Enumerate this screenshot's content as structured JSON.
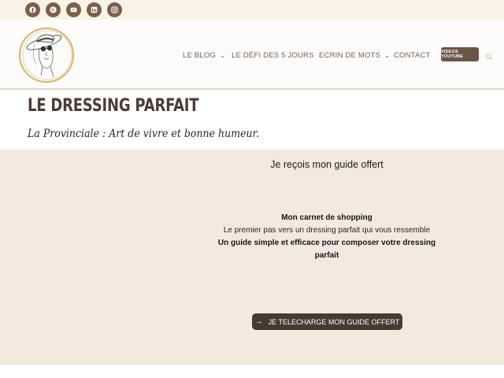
{
  "social": [
    {
      "icon": "facebook-icon"
    },
    {
      "icon": "pinterest-icon"
    },
    {
      "icon": "youtube-icon"
    },
    {
      "icon": "linkedin-icon"
    },
    {
      "icon": "instagram-icon"
    }
  ],
  "nav": {
    "items": [
      {
        "label": "LE BLOG",
        "has_dropdown": true
      },
      {
        "label": "LE DÉFI DES 5 JOURS",
        "has_dropdown": false
      },
      {
        "label": "ECRIN DE MOTS",
        "has_dropdown": true
      },
      {
        "label": "CONTACT",
        "has_dropdown": false
      }
    ],
    "video_button": "VIDEOS YOUTUBE"
  },
  "page": {
    "title": "LE DRESSING PARFAIT",
    "tagline": "La Provinciale : Art de vivre et bonne humeur."
  },
  "promo": {
    "heading": "Je reçois mon  guide offert",
    "line1": "Mon carnet de shopping",
    "line2": "Le premier pas vers un dressing parfait qui vous ressemble",
    "line3": "Un guide simple et efficace pour composer votre dressing parfait",
    "cta": "JE TELECHARGE MON GUIDE OFFERT"
  },
  "colors": {
    "accent_brown": "#6a5549",
    "promo_bg": "#f4e9df",
    "topbar_bg": "#f8f3e6",
    "cta_bg": "#473a33",
    "logo_gold": "#d6b87a"
  }
}
